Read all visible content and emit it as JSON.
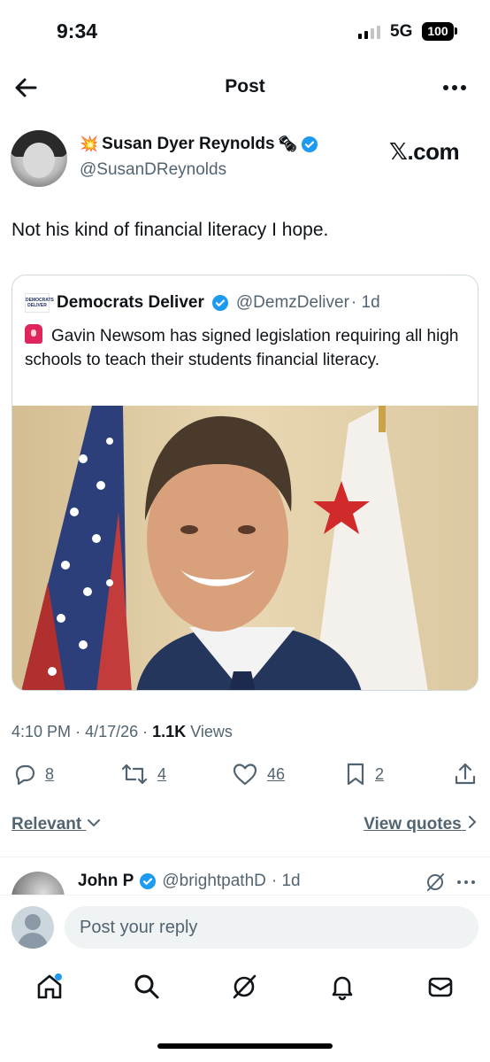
{
  "status_bar": {
    "time": "9:34",
    "network": "5G",
    "battery": "100"
  },
  "nav": {
    "title": "Post"
  },
  "post": {
    "author_name": "Susan Dyer Reynolds",
    "author_emoji_left": "💥",
    "author_emoji_right": "🗞",
    "handle": "@SusanDReynolds",
    "site_label": "𝕏.com",
    "text": "Not his kind of financial literacy I hope.",
    "quote": {
      "name": "Democrats Deliver",
      "handle": "@DemzDeliver",
      "age": "· 1d",
      "avatar_text": "DEMOCRATS DELIVER",
      "text": "Gavin Newsom has signed legislation requiring all high schools to teach their students financial literacy."
    },
    "time": "4:10 PM",
    "date": "4/17/26",
    "sep": "·",
    "views_count": "1.1K",
    "views_label": "Views",
    "stats": {
      "replies": "8",
      "reposts": "4",
      "likes": "46",
      "bookmarks": "2"
    }
  },
  "filters": {
    "relevant": "Relevant",
    "view_quotes": "View quotes"
  },
  "reply_preview": {
    "name": "John P",
    "handle": "@brightpathD",
    "age": "· 1d"
  },
  "composer": {
    "placeholder": "Post your reply"
  },
  "colors": {
    "verified": "#1d9bf0",
    "text": "#0f1419",
    "secondary": "#536471"
  },
  "icons": [
    "back-arrow-icon",
    "more-icon",
    "verified-icon",
    "reply-icon",
    "repost-icon",
    "like-icon",
    "bookmark-icon",
    "share-icon",
    "chevron-down-icon",
    "chevron-right-icon",
    "grok-icon",
    "home-icon",
    "search-icon",
    "bell-icon",
    "mail-icon"
  ]
}
